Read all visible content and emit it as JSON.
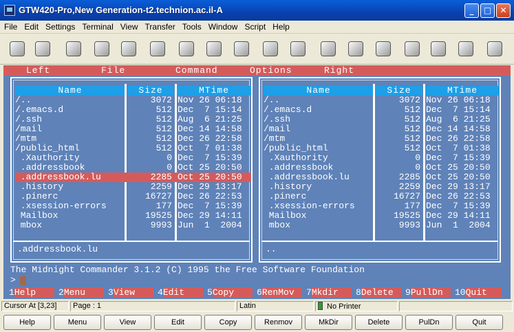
{
  "window": {
    "title": "GTW420-Pro,New Generation-t2.technion.ac.il-A",
    "minimize_glyph": "_",
    "maximize_glyph": "□",
    "close_glyph": "✕"
  },
  "menu": [
    "File",
    "Edit",
    "Settings",
    "Terminal",
    "View",
    "Transfer",
    "Tools",
    "Window",
    "Script",
    "Help"
  ],
  "toolbar_icons": [
    "check-icon",
    "car-icon",
    "speed-80-icon",
    "computer-icon",
    "printer-icon",
    "document-icon",
    "clip-icon",
    "columns-icon",
    "monitor-icon",
    "cmd-icon",
    "window-icon",
    "reload-icon",
    "keypad-icon",
    "swap-icon",
    "network-icon",
    "blank-icon",
    "tools-icon",
    "palette-icon"
  ],
  "mc": {
    "top_menu": [
      "Left",
      "File",
      "Command",
      "Options",
      "Right"
    ],
    "columns": {
      "name": "Name",
      "size": "Size",
      "mtime": "MTime"
    },
    "left_panel": {
      "rows": [
        {
          "name": "/..",
          "size": "3072",
          "mtime": "Nov 26 06:18"
        },
        {
          "name": "/.emacs.d",
          "size": "512",
          "mtime": "Dec  7 15:14"
        },
        {
          "name": "/.ssh",
          "size": "512",
          "mtime": "Aug  6 21:25"
        },
        {
          "name": "/mail",
          "size": "512",
          "mtime": "Dec 14 14:58"
        },
        {
          "name": "/mtm",
          "size": "512",
          "mtime": "Dec 26 22:58"
        },
        {
          "name": "/public_html",
          "size": "512",
          "mtime": "Oct  7 01:38"
        },
        {
          "name": " .Xauthority",
          "size": "0",
          "mtime": "Dec  7 15:39"
        },
        {
          "name": " .addressbook",
          "size": "0",
          "mtime": "Oct 25 20:50"
        },
        {
          "name": " .addressbook.lu",
          "size": "2285",
          "mtime": "Oct 25 20:50",
          "selected": true
        },
        {
          "name": " .history",
          "size": "2259",
          "mtime": "Dec 29 13:17"
        },
        {
          "name": " .pinerc",
          "size": "16727",
          "mtime": "Dec 26 22:53"
        },
        {
          "name": " .xsession-errors",
          "size": "177",
          "mtime": "Dec  7 15:39"
        },
        {
          "name": " Mailbox",
          "size": "19525",
          "mtime": "Dec 29 14:11"
        },
        {
          "name": " mbox",
          "size": "9993",
          "mtime": "Jun  1  2004"
        }
      ],
      "status": ".addressbook.lu"
    },
    "right_panel": {
      "rows": [
        {
          "name": "/..",
          "size": "3072",
          "mtime": "Nov 26 06:18"
        },
        {
          "name": "/.emacs.d",
          "size": "512",
          "mtime": "Dec  7 15:14"
        },
        {
          "name": "/.ssh",
          "size": "512",
          "mtime": "Aug  6 21:25"
        },
        {
          "name": "/mail",
          "size": "512",
          "mtime": "Dec 14 14:58"
        },
        {
          "name": "/mtm",
          "size": "512",
          "mtime": "Dec 26 22:58"
        },
        {
          "name": "/public_html",
          "size": "512",
          "mtime": "Oct  7 01:38"
        },
        {
          "name": " .Xauthority",
          "size": "0",
          "mtime": "Dec  7 15:39"
        },
        {
          "name": " .addressbook",
          "size": "0",
          "mtime": "Oct 25 20:50"
        },
        {
          "name": " .addressbook.lu",
          "size": "2285",
          "mtime": "Oct 25 20:50"
        },
        {
          "name": " .history",
          "size": "2259",
          "mtime": "Dec 29 13:17"
        },
        {
          "name": " .pinerc",
          "size": "16727",
          "mtime": "Dec 26 22:53"
        },
        {
          "name": " .xsession-errors",
          "size": "177",
          "mtime": "Dec  7 15:39"
        },
        {
          "name": " Mailbox",
          "size": "19525",
          "mtime": "Dec 29 14:11"
        },
        {
          "name": " mbox",
          "size": "9993",
          "mtime": "Jun  1  2004"
        }
      ],
      "status": ".."
    },
    "info_line": "The Midnight Commander 3.1.2 (C) 1995 the Free Software Foundation",
    "prompt": ">",
    "fkeys": [
      {
        "num": "1",
        "label": "Help"
      },
      {
        "num": "2",
        "label": "Menu"
      },
      {
        "num": "3",
        "label": "View"
      },
      {
        "num": "4",
        "label": "Edit"
      },
      {
        "num": "5",
        "label": "Copy"
      },
      {
        "num": "6",
        "label": "RenMov"
      },
      {
        "num": "7",
        "label": "Mkdir"
      },
      {
        "num": "8",
        "label": "Delete"
      },
      {
        "num": "9",
        "label": "PullDn"
      },
      {
        "num": "10",
        "label": "Quit"
      }
    ]
  },
  "statusbar": {
    "cursor": "Cursor At [3,23]",
    "page": "Page : 1",
    "encoding": "Latin",
    "printer": "No Printer"
  },
  "buttons": [
    "Help",
    "Menu",
    "View",
    "Edit",
    "Copy",
    "Renmov",
    "MkDir",
    "Delete",
    "PulDn",
    "Quit"
  ]
}
